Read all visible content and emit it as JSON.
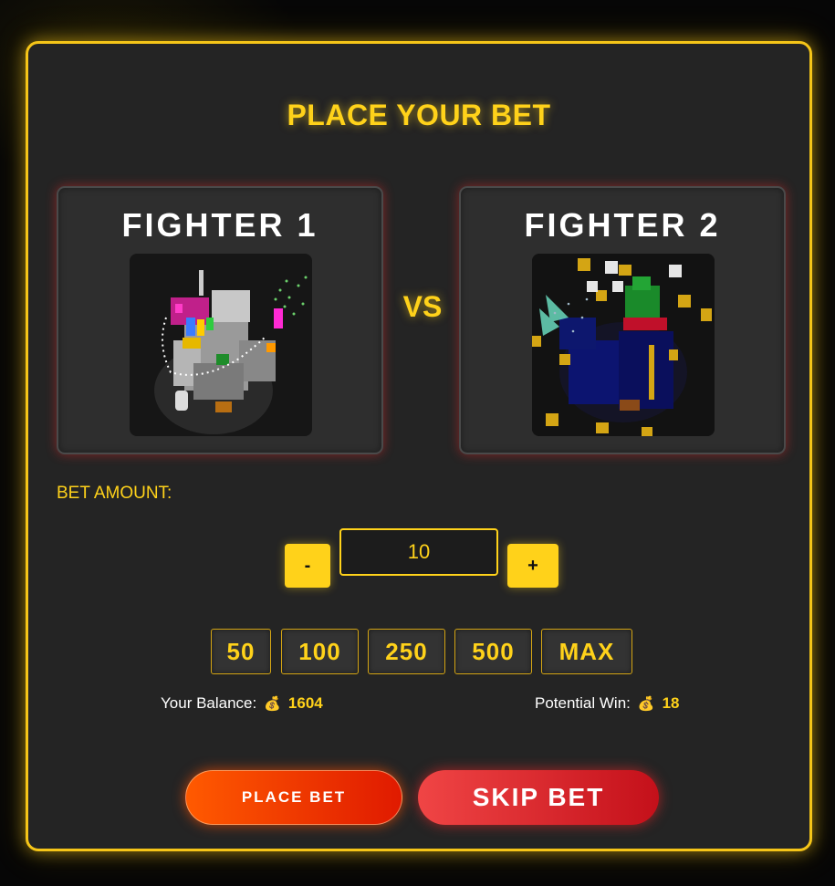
{
  "modal": {
    "title": "PLACE YOUR BET",
    "vs_label": "VS"
  },
  "fighters": [
    {
      "name": "FIGHTER 1"
    },
    {
      "name": "FIGHTER 2"
    }
  ],
  "bet": {
    "label": "BET AMOUNT:",
    "value": "10",
    "minus_label": "-",
    "plus_label": "+",
    "quick_amounts": [
      "50",
      "100",
      "250",
      "500",
      "MAX"
    ]
  },
  "balance": {
    "label": "Your Balance:",
    "icon": "money-bag-icon",
    "value": "1604"
  },
  "potential": {
    "label": "Potential Win:",
    "icon": "money-bag-icon",
    "value": "18"
  },
  "actions": {
    "place_label": "PLACE BET",
    "skip_label": "SKIP BET"
  },
  "colors": {
    "accent": "#ffd21a",
    "panel": "#242424",
    "place_button": "#ff5a00",
    "skip_button": "#e03535"
  }
}
